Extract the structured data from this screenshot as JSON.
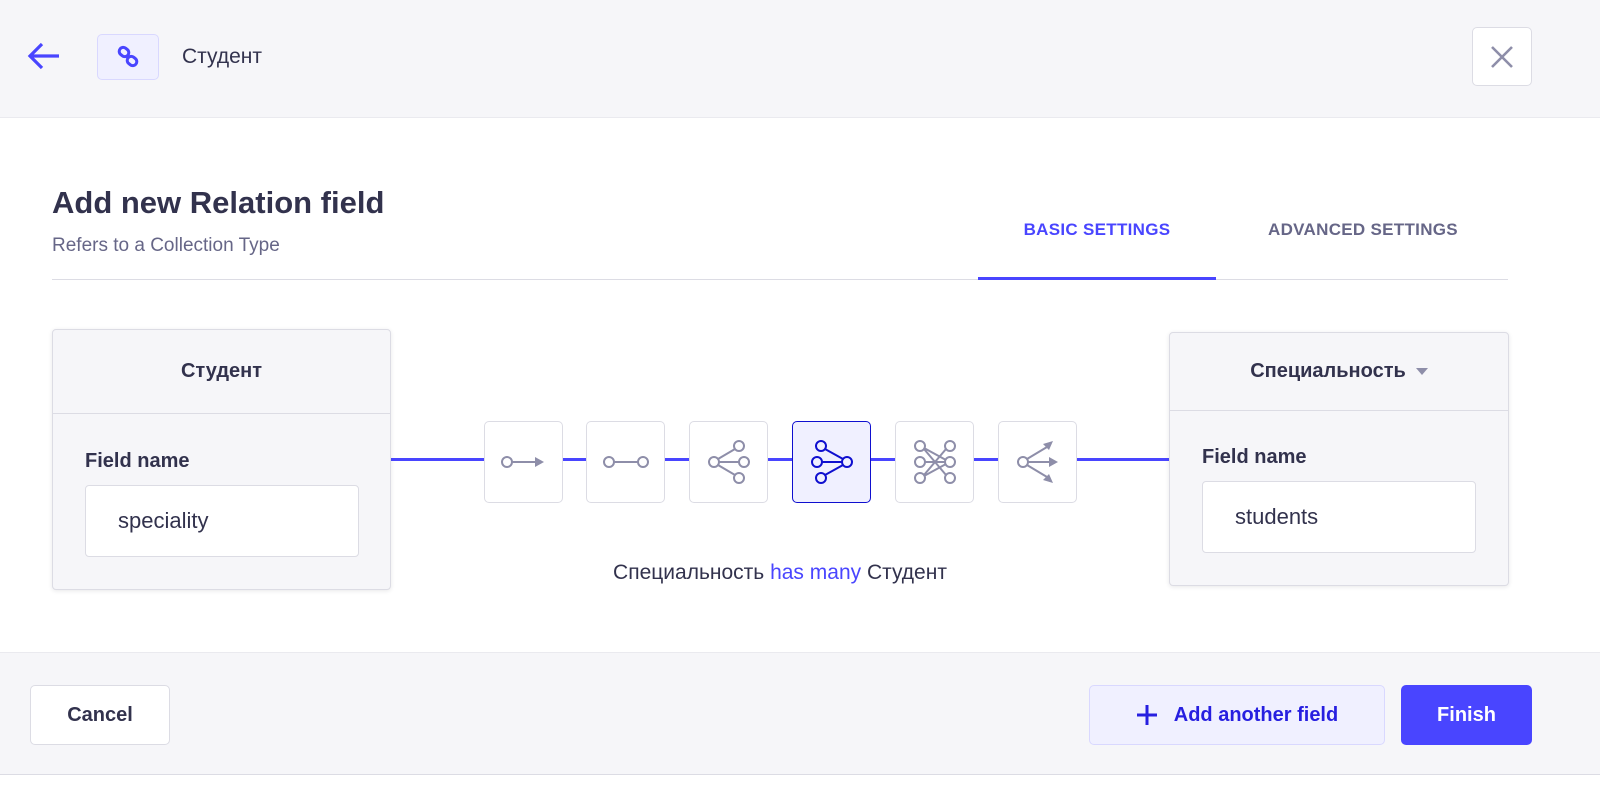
{
  "header": {
    "title": "Студент",
    "back_icon": "arrow-left-icon",
    "type_icon": "link-icon",
    "close_icon": "close-icon"
  },
  "modal": {
    "title": "Add new Relation field",
    "subtitle": "Refers to a Collection Type",
    "tabs": [
      {
        "label": "BASIC SETTINGS",
        "active": true
      },
      {
        "label": "ADVANCED SETTINGS",
        "active": false
      }
    ]
  },
  "left": {
    "name": "Студент",
    "field_label": "Field name",
    "field_value": "speciality"
  },
  "right": {
    "name": "Специальность",
    "field_label": "Field name",
    "field_value": "students"
  },
  "relations": [
    "one-way",
    "one-to-one",
    "one-to-many",
    "many-to-one",
    "many-to-many",
    "many-way"
  ],
  "selected_relation": "many-to-one",
  "description": {
    "pre": "Специальность",
    "mid": "has many",
    "post": "Студент"
  },
  "footer": {
    "cancel": "Cancel",
    "add_another": "Add another field",
    "finish": "Finish"
  },
  "colors": {
    "accent": "#4945ff",
    "text": "#32324d",
    "muted": "#666687"
  }
}
